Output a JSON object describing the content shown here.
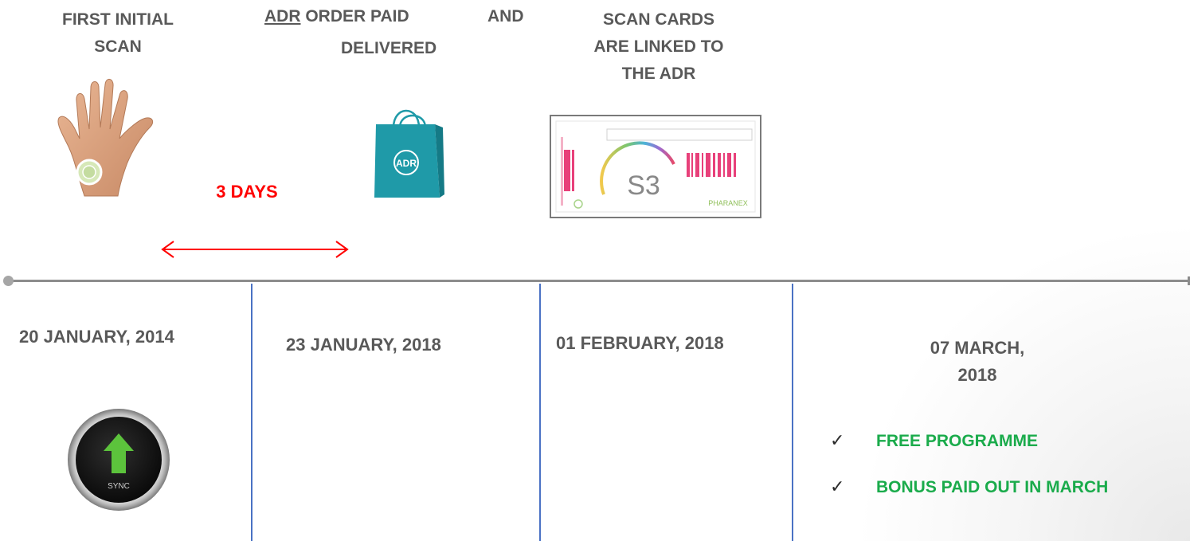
{
  "steps": {
    "scan": {
      "line1": "FIRST INITIAL",
      "line2": "SCAN"
    },
    "adr": {
      "adr_word": "ADR",
      "rest1": " ORDER PAID",
      "and_word": "AND",
      "line2": "DELIVERED"
    },
    "cards": {
      "line1": "SCAN CARDS",
      "line2": "ARE LINKED TO",
      "line3": "THE ADR"
    }
  },
  "duration_label": "3 DAYS",
  "dates": {
    "d1": "20 JANUARY, 2014",
    "d2": "23 JANUARY, 2018",
    "d3": "01 FEBRUARY, 2018",
    "d4_line1": "07 MARCH,",
    "d4_line2": "2018"
  },
  "checklist": [
    {
      "tick": "✓",
      "label": "FREE PROGRAMME"
    },
    {
      "tick": "✓",
      "label": "BONUS PAID OUT IN MARCH"
    }
  ],
  "icons": {
    "bag_logo": "ADR",
    "card_logo": "S3",
    "card_brand": "PHARANEX",
    "sync_label": "SYNC"
  },
  "colors": {
    "text": "#595959",
    "accent_red": "#ff0000",
    "accent_green": "#1aab4b",
    "divider_blue": "#4a72c4",
    "bag_teal": "#1f9aa8"
  }
}
